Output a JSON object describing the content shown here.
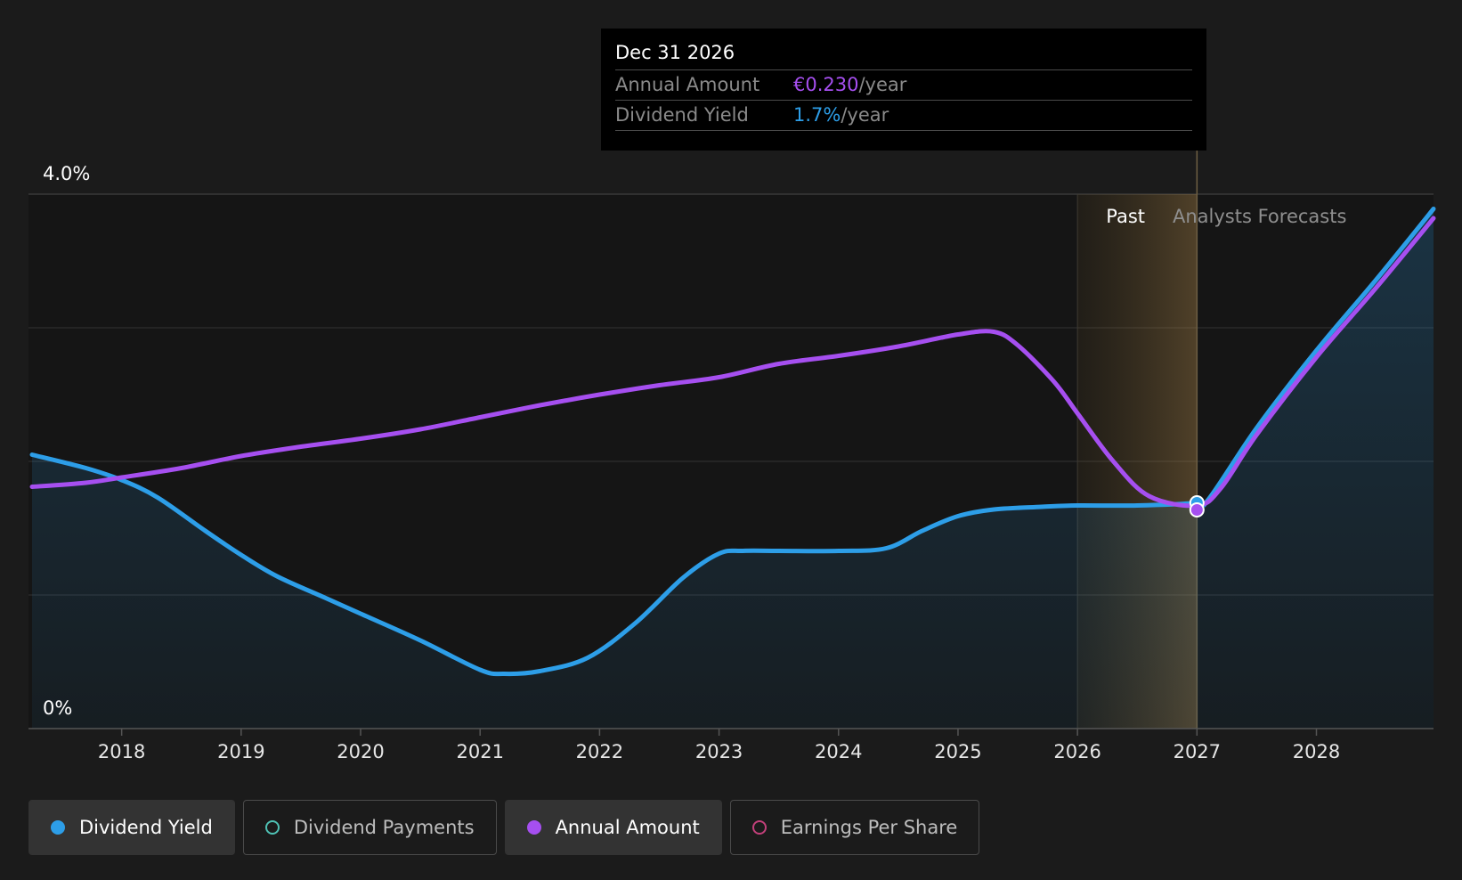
{
  "colors": {
    "dividend_yield": "#2d9ee8",
    "annual_amount": "#a64ff0",
    "dividend_payments": "#4fc1b4",
    "earnings_per_share": "#c2407a",
    "background": "#1b1b1b"
  },
  "tooltip": {
    "date": "Dec 31 2026",
    "annual_amount_label": "Annual Amount",
    "annual_amount_value": "€0.230",
    "annual_amount_unit": "/year",
    "dividend_yield_label": "Dividend Yield",
    "dividend_yield_value": "1.7%",
    "dividend_yield_unit": "/year"
  },
  "regions": {
    "past_label": "Past",
    "forecast_label": "Analysts Forecasts"
  },
  "legend": [
    {
      "label": "Dividend Yield",
      "icon": "filled-dot",
      "color": "#2d9ee8",
      "active": true
    },
    {
      "label": "Dividend Payments",
      "icon": "hollow-dot",
      "color": "#4fc1b4",
      "active": false
    },
    {
      "label": "Annual Amount",
      "icon": "filled-dot",
      "color": "#a64ff0",
      "active": true
    },
    {
      "label": "Earnings Per Share",
      "icon": "hollow-dot",
      "color": "#c2407a",
      "active": false
    }
  ],
  "chart_data": {
    "type": "line",
    "title": "",
    "xlabel": "",
    "ylabel": "",
    "xlim": [
      2017.22,
      2028.98
    ],
    "ylim": [
      0,
      4.0
    ],
    "y_tick_labels": [
      "4.0%",
      "0%"
    ],
    "x_tick_labels": [
      "2018",
      "2019",
      "2020",
      "2021",
      "2022",
      "2023",
      "2024",
      "2025",
      "2026",
      "2027",
      "2028"
    ],
    "x_ticks": [
      2018,
      2019,
      2020,
      2021,
      2022,
      2023,
      2024,
      2025,
      2026,
      2027,
      2028
    ],
    "grid": true,
    "past_boundary": 2027.0,
    "highlight_start": 2026.0,
    "series": [
      {
        "name": "Dividend Yield",
        "unit": "%",
        "x": [
          2017.25,
          2017.7,
          2018.0,
          2018.3,
          2018.7,
          2019.0,
          2019.3,
          2019.7,
          2020.0,
          2020.5,
          2021.0,
          2021.2,
          2021.5,
          2021.9,
          2022.3,
          2022.7,
          2023.0,
          2023.2,
          2023.5,
          2024.0,
          2024.4,
          2024.7,
          2025.0,
          2025.3,
          2025.7,
          2026.0,
          2026.5,
          2027.0,
          2027.1,
          2027.5,
          2028.0,
          2028.5,
          2028.98
        ],
        "y": [
          2.05,
          1.95,
          1.86,
          1.73,
          1.48,
          1.3,
          1.14,
          0.98,
          0.86,
          0.66,
          0.44,
          0.41,
          0.43,
          0.53,
          0.79,
          1.13,
          1.31,
          1.33,
          1.33,
          1.33,
          1.35,
          1.48,
          1.59,
          1.64,
          1.66,
          1.67,
          1.67,
          1.69,
          1.72,
          2.25,
          2.83,
          3.36,
          3.89
        ]
      },
      {
        "name": "Annual Amount",
        "unit": "€/year",
        "x": [
          2017.25,
          2017.7,
          2018.0,
          2018.5,
          2019.0,
          2019.5,
          2020.0,
          2020.5,
          2021.0,
          2021.5,
          2022.0,
          2022.5,
          2023.0,
          2023.5,
          2024.0,
          2024.5,
          2025.0,
          2025.3,
          2025.5,
          2025.8,
          2026.0,
          2026.3,
          2026.6,
          2027.0,
          2027.2,
          2027.5,
          2028.0,
          2028.5,
          2028.98
        ],
        "y": [
          1.81,
          1.84,
          1.88,
          1.95,
          2.04,
          2.11,
          2.17,
          2.24,
          2.33,
          2.42,
          2.5,
          2.57,
          2.63,
          2.73,
          2.79,
          2.86,
          2.95,
          2.97,
          2.87,
          2.6,
          2.36,
          2.0,
          1.74,
          1.67,
          1.8,
          2.2,
          2.78,
          3.3,
          3.82
        ]
      }
    ]
  }
}
